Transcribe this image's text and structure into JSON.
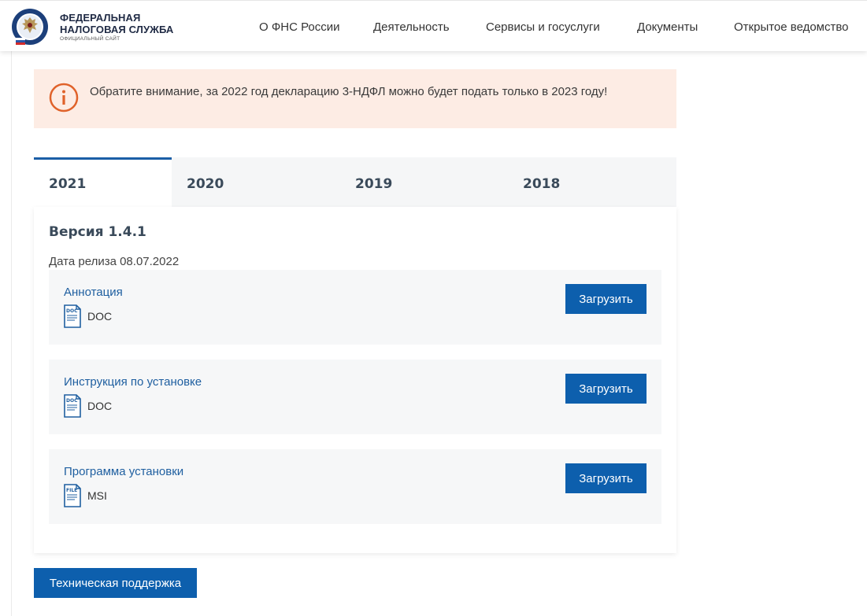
{
  "header": {
    "logo_line1": "ФЕДЕРАЛЬНАЯ",
    "logo_line2": "НАЛОГОВАЯ СЛУЖБА",
    "logo_sub": "ОФИЦИАЛЬНЫЙ САЙТ",
    "nav": [
      {
        "label": "О ФНС России"
      },
      {
        "label": "Деятельность"
      },
      {
        "label": "Сервисы и госуслуги"
      },
      {
        "label": "Документы"
      },
      {
        "label": "Открытое ведомство"
      }
    ]
  },
  "alert": {
    "text": "Обратите внимание, за 2022 год декларацию 3-НДФЛ можно будет подать только в 2023 году!",
    "icon": "info-circle-icon",
    "color": "#e0622a"
  },
  "tabs": [
    {
      "label": "2021",
      "active": true
    },
    {
      "label": "2020",
      "active": false
    },
    {
      "label": "2019",
      "active": false
    },
    {
      "label": "2018",
      "active": false
    }
  ],
  "card": {
    "version": "Версия 1.4.1",
    "release": "Дата релиза 08.07.2022",
    "files": [
      {
        "name": "Аннотация",
        "type": "DOC",
        "icon_label": "DOC",
        "button": "Загрузить"
      },
      {
        "name": "Инструкция по установке",
        "type": "DOC",
        "icon_label": "DOC",
        "button": "Загрузить"
      },
      {
        "name": "Программа установки",
        "type": "MSI",
        "icon_label": "FILE",
        "button": "Загрузить"
      }
    ]
  },
  "support_button": "Техническая поддержка",
  "colors": {
    "accent": "#0d5fad",
    "alert_bg": "#fdece4",
    "link": "#1f5fa0"
  }
}
